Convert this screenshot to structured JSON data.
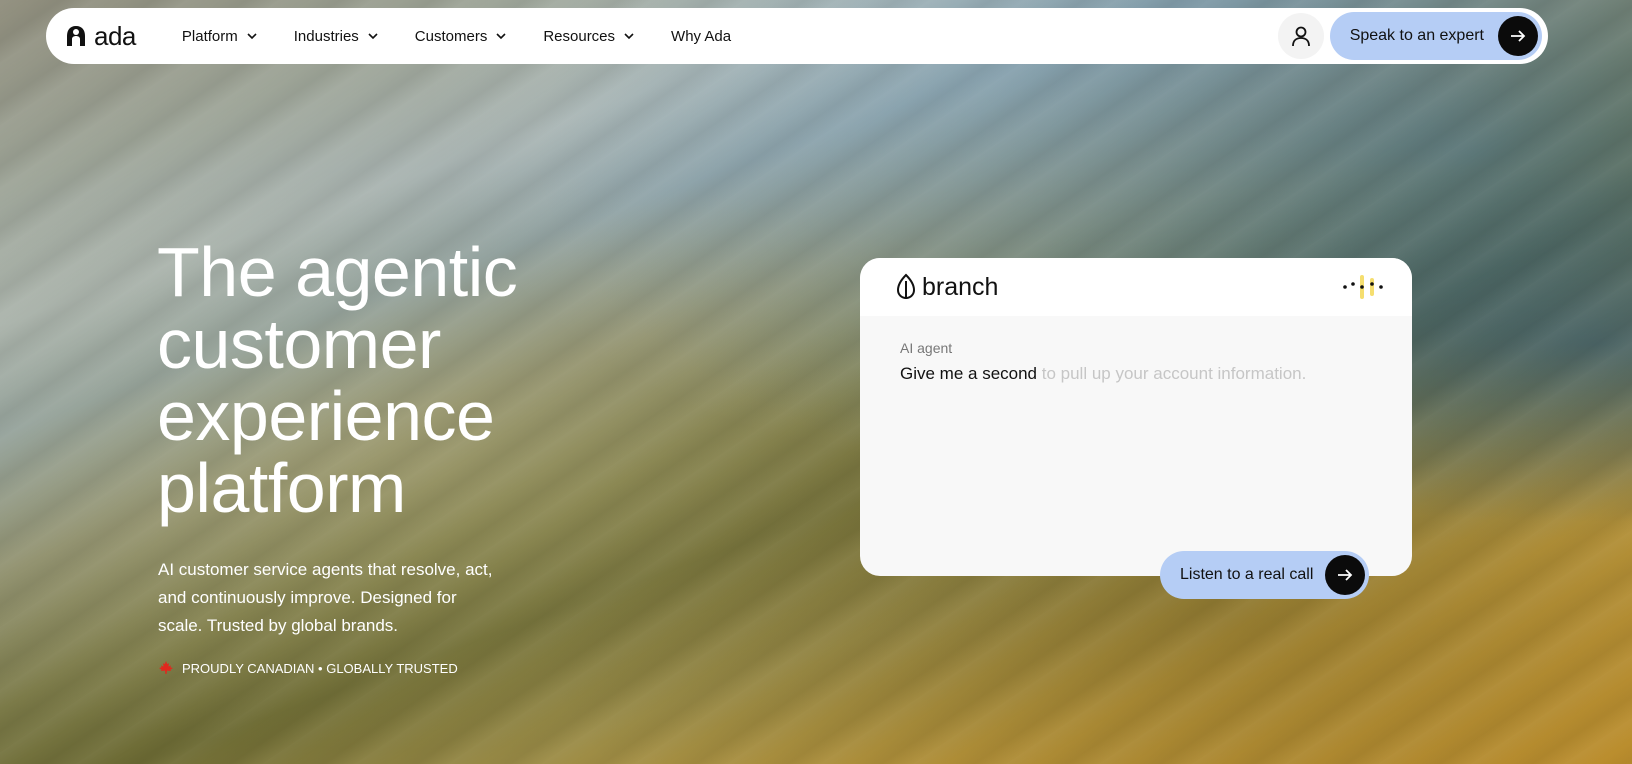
{
  "brand": {
    "logo_text": "ada"
  },
  "nav": {
    "items": [
      {
        "label": "Platform",
        "dropdown": true
      },
      {
        "label": "Industries",
        "dropdown": true
      },
      {
        "label": "Customers",
        "dropdown": true
      },
      {
        "label": "Resources",
        "dropdown": true
      },
      {
        "label": "Why Ada",
        "dropdown": false
      }
    ],
    "cta_label": "Speak to an expert"
  },
  "hero": {
    "title_lines": [
      "The agentic",
      "customer",
      "experience",
      "platform"
    ],
    "subtitle": "AI customer service agents that resolve, act, and continuously improve. Designed for scale. Trusted by global brands.",
    "badge": "PROUDLY CANADIAN • GLOBALLY TRUSTED"
  },
  "demo_card": {
    "brand_name": "branch",
    "speaker": "AI agent",
    "message_spoken": "Give me a second",
    "message_pending": "to pull up your account information.",
    "listen_label": "Listen to a real call"
  },
  "colors": {
    "cta_bg": "#b5cdf5",
    "arrow_bg": "#0b0b0b",
    "maple": "#e0281e",
    "wave_accent": "#f2d64b"
  }
}
